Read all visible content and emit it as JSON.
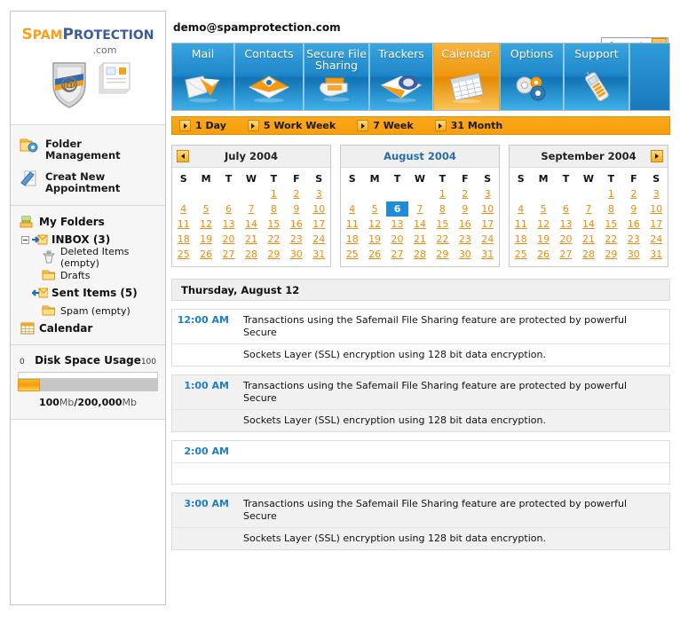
{
  "brand": {
    "part1": "S",
    "part2": "PAM",
    "part3": "P",
    "part4": "ROTECTION",
    "domain": ".com"
  },
  "header": {
    "account": "demo@spamprotection.com",
    "logout_label": "Logout"
  },
  "tabs": [
    {
      "label": "Mail",
      "icon": "mail-icon",
      "active": false
    },
    {
      "label": "Contacts",
      "icon": "contacts-envelope-icon",
      "active": false
    },
    {
      "label": "Secure File Sharing",
      "icon": "secure-folder-icon",
      "active": false
    },
    {
      "label": "Trackers",
      "icon": "tracker-icon",
      "active": false
    },
    {
      "label": "Calendar",
      "icon": "calendar-icon",
      "active": true
    },
    {
      "label": "Options",
      "icon": "gears-icon",
      "active": false
    },
    {
      "label": "Support",
      "icon": "phone-icon",
      "active": false
    }
  ],
  "viewbar": [
    {
      "label": "1 Day"
    },
    {
      "label": "5 Work Week"
    },
    {
      "label": "7 Week"
    },
    {
      "label": "31 Month"
    }
  ],
  "sidebar": {
    "menu": [
      {
        "label": "Folder Management",
        "icon": "folder-gear-icon"
      },
      {
        "label": "Creat New Appointment",
        "icon": "new-appointment-icon"
      }
    ],
    "folders": [
      {
        "label": "My Folders",
        "icon": "my-folders-icon",
        "level": 0,
        "bold": true
      },
      {
        "label": "INBOX (3)",
        "icon": "inbox-arrow-icon",
        "level": 1,
        "bold": true,
        "toggle": true
      },
      {
        "label": "Deleted Items (empty)",
        "icon": "trash-icon",
        "level": 2,
        "bold": false
      },
      {
        "label": "Drafts",
        "icon": "folder-icon",
        "level": 2,
        "bold": false
      },
      {
        "label": "Sent Items (5)",
        "icon": "sent-arrow-icon",
        "level": 2,
        "bold": true
      },
      {
        "label": "Spam (empty)",
        "icon": "folder-icon",
        "level": 2,
        "bold": false
      },
      {
        "label": "Calendar",
        "icon": "calendar-small-icon",
        "level": 0,
        "bold": true
      }
    ],
    "disk": {
      "title": "Disk Space Usage",
      "min": "0",
      "max": "100",
      "used": "100",
      "used_unit": "Mb",
      "separator": "/",
      "total": "200,000",
      "total_unit": "Mb",
      "percent": 16,
      "fill_color": "#F79A0B"
    }
  },
  "calendars": [
    {
      "title": "July 2004",
      "current": false,
      "nav": "prev",
      "daynames": [
        "S",
        "M",
        "T",
        "W",
        "T",
        "F",
        "S"
      ],
      "weeks": [
        [
          "",
          "",
          "",
          "",
          "1",
          "2",
          "3"
        ],
        [
          "4",
          "5",
          "6",
          "7",
          "8",
          "9",
          "10"
        ],
        [
          "11",
          "12",
          "13",
          "14",
          "15",
          "16",
          "17"
        ],
        [
          "18",
          "19",
          "20",
          "21",
          "22",
          "23",
          "24"
        ],
        [
          "25",
          "26",
          "27",
          "28",
          "29",
          "30",
          "31"
        ]
      ],
      "selected": null
    },
    {
      "title": "August 2004",
      "current": true,
      "nav": "none",
      "daynames": [
        "S",
        "M",
        "T",
        "W",
        "T",
        "F",
        "S"
      ],
      "weeks": [
        [
          "",
          "",
          "",
          "",
          "1",
          "2",
          "3"
        ],
        [
          "4",
          "5",
          "6",
          "7",
          "8",
          "9",
          "10"
        ],
        [
          "11",
          "12",
          "13",
          "14",
          "15",
          "16",
          "17"
        ],
        [
          "18",
          "19",
          "20",
          "21",
          "22",
          "23",
          "24"
        ],
        [
          "25",
          "26",
          "27",
          "28",
          "29",
          "30",
          "31"
        ]
      ],
      "selected": "6"
    },
    {
      "title": "September 2004",
      "current": false,
      "nav": "next",
      "daynames": [
        "S",
        "M",
        "T",
        "W",
        "T",
        "F",
        "S"
      ],
      "weeks": [
        [
          "",
          "",
          "",
          "",
          "1",
          "2",
          "3"
        ],
        [
          "4",
          "5",
          "6",
          "7",
          "8",
          "9",
          "10"
        ],
        [
          "11",
          "12",
          "13",
          "14",
          "15",
          "16",
          "17"
        ],
        [
          "18",
          "19",
          "20",
          "21",
          "22",
          "23",
          "24"
        ],
        [
          "25",
          "26",
          "27",
          "28",
          "29",
          "30",
          "31"
        ]
      ],
      "selected": null
    }
  ],
  "day_title": "Thursday, August 12",
  "appointments": [
    {
      "time": "12:00 AM",
      "line1": "Transactions using the Safemail File Sharing feature are protected by powerful Secure",
      "line2": "Sockets Layer (SSL) encryption using 128 bit data encryption."
    },
    {
      "time": "1:00 AM",
      "line1": "Transactions using the Safemail File Sharing feature are protected by powerful Secure",
      "line2": "Sockets Layer (SSL) encryption using 128 bit data encryption."
    },
    {
      "time": "2:00 AM",
      "line1": "",
      "line2": ""
    },
    {
      "time": "3:00 AM",
      "line1": "Transactions using the Safemail File Sharing feature are protected by powerful Secure",
      "line2": "Sockets Layer (SSL) encryption using 128 bit data encryption."
    }
  ]
}
